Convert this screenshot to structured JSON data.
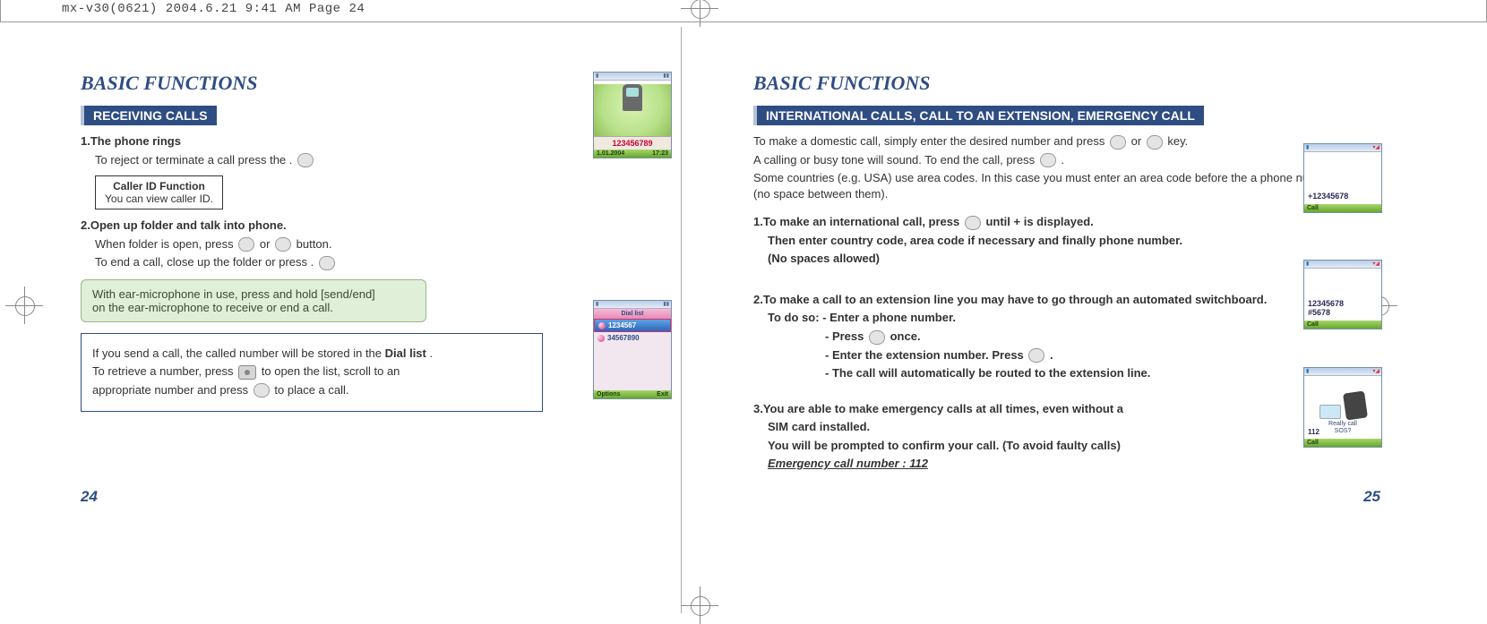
{
  "print_header": "mx-v30(0621)  2004.6.21  9:41 AM  Page 24",
  "page_left": {
    "title": "BASIC FUNCTIONS",
    "section_bar": "RECEIVING CALLS",
    "s1_head": "1.The phone rings",
    "s1_line": "To reject or terminate a call press the       .",
    "caller_id_title": "Caller ID Function",
    "caller_id_text": "You can view caller ID.",
    "s2_head": "2.Open up folder and talk into phone.",
    "s2_line1_a": "When folder is open, press ",
    "s2_line1_b": " or ",
    "s2_line1_c": " button.",
    "s2_line2": "To end a call, close up the folder or press       .",
    "note_l1": "With ear-microphone in use, press and hold [send/end]",
    "note_l2": "on the ear-microphone to receive or end a call.",
    "dl_l1_a": "If you send a call, the called number will be stored in the ",
    "dl_l1_b": "Dial list",
    "dl_l1_c": ".",
    "dl_l2_a": "To retrieve a number, press ",
    "dl_l2_b": " to open the list, scroll to an",
    "dl_l3_a": "appropriate number and press ",
    "dl_l3_b": " to place a call.",
    "page_num": "24",
    "shot1": {
      "number": "123456789",
      "footer_l": "1.01.2004",
      "footer_r": "17:23"
    },
    "shot2": {
      "title": "Dial list",
      "row1": "1234567",
      "row2": "34567890",
      "footer_l": "Options",
      "footer_r": "Exit"
    }
  },
  "page_right": {
    "title": "BASIC FUNCTIONS",
    "section_bar": "INTERNATIONAL CALLS, CALL TO AN EXTENSION, EMERGENCY CALL",
    "intro1_a": "To make a domestic call, simply enter the desired number and press ",
    "intro1_b": " or ",
    "intro1_c": " key.",
    "intro2_a": "A calling or busy tone will sound. To end the call, press ",
    "intro2_b": ".",
    "intro3": "Some countries (e.g. USA) use area codes. In this case you must enter an area code before the a phone number (no space between them).",
    "s1_l1_a": "1.To make an international call, press ",
    "s1_l1_b": " until + is displayed.",
    "s1_l2": "Then enter country code, area code if necessary and finally phone number.",
    "s1_l3": "(No spaces allowed)",
    "s2_l1": "2.To make a call to an extension line you may have to go through an automated switchboard.",
    "s2_sub": "To do so: - Enter a phone number.",
    "s2_b1_a": "- Press ",
    "s2_b1_b": " once.",
    "s2_b2_a": "- Enter the extension number. Press ",
    "s2_b2_b": ".",
    "s2_b3": "- The call will automatically be routed to the extension line.",
    "s3_l1": "3.You are able to make emergency calls at all times, even without a",
    "s3_l2": "SIM card installed.",
    "s3_l3": "You will be prompted to confirm your call. (To avoid faulty calls)",
    "s3_l4": "Emergency call number : 112",
    "page_num": "25",
    "shotA": {
      "dialed": "+12345678",
      "footer": "Call"
    },
    "shotB": {
      "dialed_l1": "12345678",
      "dialed_l2": "#5678",
      "footer": "Call"
    },
    "shotC": {
      "msg_l1": "Really call",
      "msg_l2": "SOS?",
      "num": "112",
      "footer": "Call"
    }
  }
}
